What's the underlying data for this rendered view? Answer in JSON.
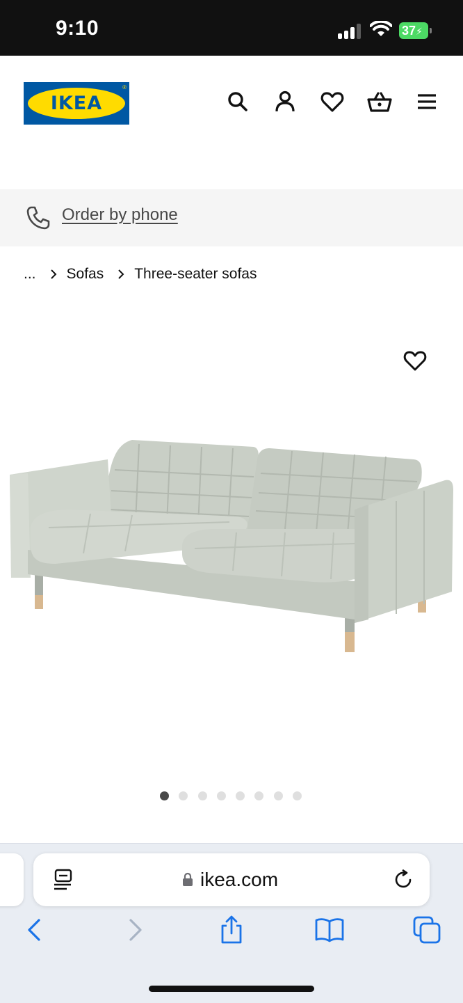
{
  "status_bar": {
    "time": "9:10",
    "battery_level": "37",
    "signal_bars": 3,
    "icons": [
      "cellular-signal-icon",
      "wifi-icon",
      "battery-charging-icon"
    ]
  },
  "header": {
    "logo_text": "IKEA",
    "logo_reg": "®",
    "icons": [
      "search-icon",
      "profile-icon",
      "heart-icon",
      "shopping-basket-icon",
      "hamburger-menu-icon"
    ],
    "colors": {
      "logo_blue": "#0058a3",
      "logo_yellow": "#ffdb00"
    }
  },
  "phone_strip": {
    "icon": "phone-icon",
    "link_label": "Order by phone"
  },
  "breadcrumb": {
    "items": [
      {
        "label": "..."
      },
      {
        "label": "Sofas"
      },
      {
        "label": "Three-seater sofas"
      }
    ]
  },
  "product": {
    "image": "sofa-image",
    "favourite_icon": "heart-outline-icon",
    "carousel": {
      "total": 8,
      "active_index": 0
    }
  },
  "browser": {
    "url": "ikea.com",
    "icons": [
      "reader-mode-icon",
      "lock-icon",
      "reload-icon",
      "back-icon",
      "forward-icon",
      "share-icon",
      "bookmarks-icon",
      "tabs-icon"
    ],
    "colors": {
      "accent": "#1a73e8",
      "disabled": "#a8b4c4"
    }
  }
}
